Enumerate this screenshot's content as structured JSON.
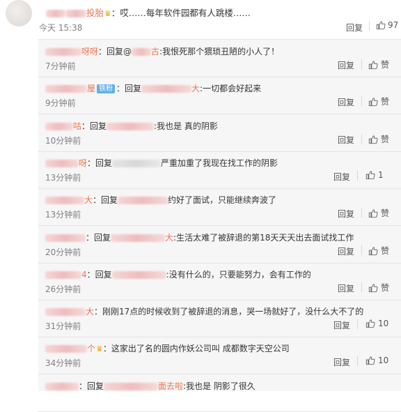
{
  "main_comment": {
    "text_prefix": "：",
    "text": "哎……每年软件园都有人跳楼……",
    "time_prefix": "今天",
    "time": "15:38",
    "reply_label": "回复",
    "like_count": "97",
    "nick_visible": "投胎"
  },
  "replies": [
    {
      "nick_tail": "呀呀",
      "reply_word": "：回复@",
      "target_tail": "古",
      "content": ":我恨死那个猥琐丑陋的小人了！",
      "time": "7分钟前",
      "reply_label": "回复",
      "like": "赞"
    },
    {
      "nick_tail": "屋",
      "badge": "铁粉",
      "reply_word": "：回复",
      "target_tail": "大",
      "content": ":一切都会好起来",
      "time": "9分钟前",
      "reply_label": "回复",
      "like": "赞"
    },
    {
      "nick_tail": "咕",
      "reply_word": "：回复",
      "target_tail": "",
      "content": ":我也是 真的阴影",
      "time": "10分钟前",
      "reply_label": "回复",
      "like": "赞"
    },
    {
      "nick_tail": "呀",
      "reply_word": "：回复",
      "target_tail": "",
      "content": "严重加重了我现在找工作的阴影",
      "time": "13分钟前",
      "reply_label": "回复",
      "like": "1"
    },
    {
      "nick_tail": "大",
      "reply_word": "：回复",
      "target_tail": "",
      "content": "约好了面试，只能继续奔波了",
      "time": "13分钟前",
      "reply_label": "回复",
      "like": "赞"
    },
    {
      "nick_tail": "",
      "reply_word": "：回复",
      "target_tail": "大",
      "content": ":生活太难了被辞退的第18天天天出去面试找工作",
      "time": "20分钟前",
      "reply_label": "回复",
      "like": "赞"
    },
    {
      "nick_tail": "4",
      "reply_word": "：回复",
      "target_tail": "",
      "content": ":没有什么的，只要能努力，会有工作的",
      "time": "26分钟前",
      "reply_label": "回复",
      "like": "赞"
    },
    {
      "nick_tail": "大",
      "reply_word": "：",
      "target_tail": "",
      "content": "刚刚17点的时候收到了被辞退的消息，哭一场就好了，没什么大不了的",
      "time": "31分钟前",
      "reply_label": "回复",
      "like": "10"
    },
    {
      "nick_tail": "个",
      "reply_word": "：",
      "target_tail": "",
      "content": "这家出了名的圆内作妖公司叫    成都数字天空公司",
      "time": "34分钟前",
      "reply_label": "回复",
      "like": "10"
    },
    {
      "nick_tail": "",
      "reply_word": "：回复",
      "target_tail": "面去啦",
      "content": ":我也是 阴影了很久",
      "time": "",
      "reply_label": "",
      "like": ""
    }
  ],
  "colors": {
    "nick": "#eb7350",
    "badge": "#5fb0e8",
    "replies_bg": "#f6f6f6"
  },
  "icons": {
    "like": "thumbs-up-icon",
    "crown": "crown-icon"
  }
}
